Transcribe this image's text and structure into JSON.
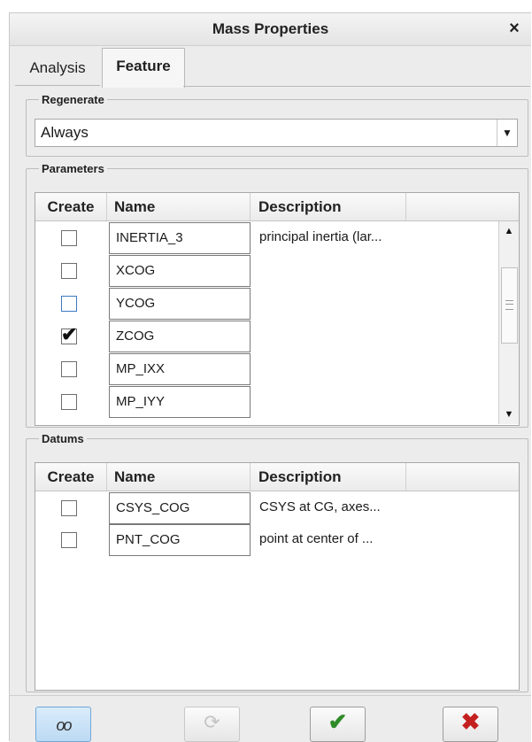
{
  "window": {
    "title": "Mass Properties",
    "close_symbol": "×"
  },
  "tabs": [
    {
      "label": "Analysis",
      "selected": false
    },
    {
      "label": "Feature",
      "selected": true
    }
  ],
  "regenerate": {
    "legend": "Regenerate",
    "value": "Always",
    "arrow": "▼"
  },
  "parameters": {
    "legend": "Parameters",
    "columns": [
      "Create",
      "Name",
      "Description"
    ],
    "rows": [
      {
        "checked": false,
        "name": "INERTIA_3",
        "description": "principal inertia (lar..."
      },
      {
        "checked": false,
        "name": "XCOG",
        "description": ""
      },
      {
        "checked": false,
        "name": "YCOG",
        "description": ""
      },
      {
        "checked": true,
        "name": "ZCOG",
        "description": ""
      },
      {
        "checked": false,
        "name": "MP_IXX",
        "description": ""
      },
      {
        "checked": false,
        "name": "MP_IYY",
        "description": ""
      }
    ],
    "check_mark": "✔",
    "scroll_up": "▲",
    "scroll_down": "▼"
  },
  "datums": {
    "legend": "Datums",
    "columns": [
      "Create",
      "Name",
      "Description"
    ],
    "rows": [
      {
        "checked": false,
        "name": "CSYS_COG",
        "description": "CSYS at CG, axes..."
      },
      {
        "checked": false,
        "name": "PNT_COG",
        "description": "point at center of ..."
      }
    ]
  },
  "buttons": {
    "preview_glyph": "oo",
    "repaint_glyph": "⟳",
    "ok_glyph": "✔",
    "cancel_glyph": "✖"
  },
  "colors": {
    "ok": "#2e8b28",
    "cancel": "#c42020",
    "preview_bg": "#bcdaf3"
  }
}
